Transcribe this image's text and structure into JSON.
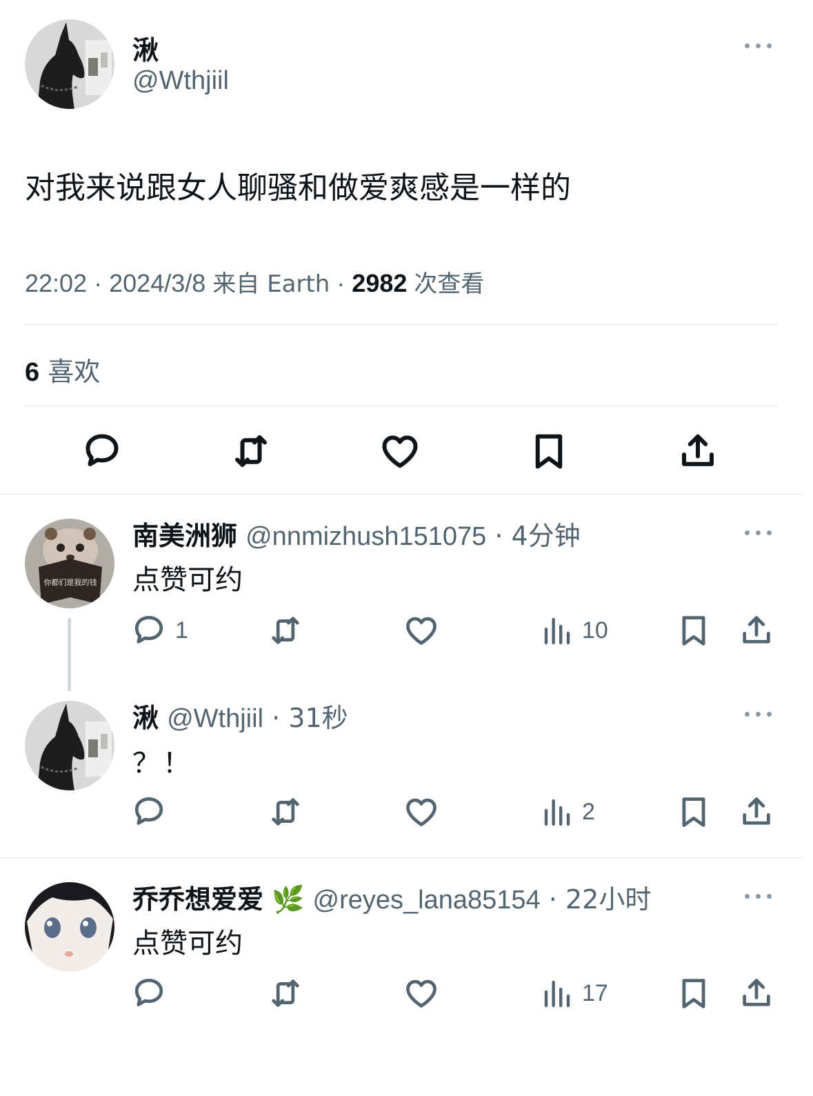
{
  "main_post": {
    "name": "湫",
    "handle": "@Wthjiil",
    "text": "对我来说跟女人聊骚和做爱爽感是一样的",
    "time": "22:02",
    "date": "2024/3/8",
    "source": "来自 Earth",
    "views_count": "2982",
    "views_label": "次查看",
    "likes_count": "6",
    "likes_label": "喜欢"
  },
  "replies": [
    {
      "name": "南美洲狮",
      "handle": "@nnmizhush151075",
      "time": "4分钟",
      "text": "点赞可约",
      "reply_count": "1",
      "views": "10",
      "avatar_book_text": "你都们是我的钱"
    },
    {
      "name": "湫",
      "handle": "@Wthjiil",
      "time": "31秒",
      "text": "？！",
      "reply_count": "",
      "views": "2"
    },
    {
      "name": "乔乔想爱爱",
      "name_emoji": "🌿",
      "handle": "@reyes_lana85154",
      "time": "22小时",
      "text": "点赞可约",
      "reply_count": "",
      "views": "17"
    }
  ],
  "separator": "·",
  "colors": {
    "text": "#0f1419",
    "secondary": "#536471",
    "divider": "#e6e9ec"
  },
  "icons": [
    "reply-icon",
    "retweet-icon",
    "like-icon",
    "bookmark-icon",
    "share-icon",
    "views-icon",
    "more-icon"
  ]
}
